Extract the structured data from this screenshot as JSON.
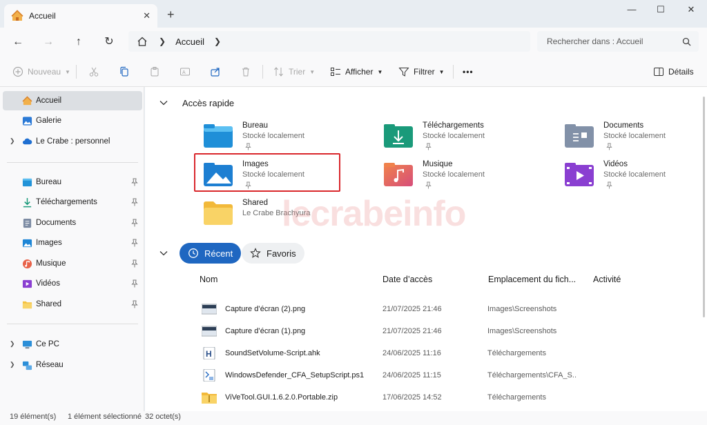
{
  "window": {
    "tab_title": "Accueil",
    "tab_close": "✕",
    "new_tab": "+",
    "minimize": "—",
    "maximize": "☐",
    "close": "✕"
  },
  "address": {
    "crumb": "Accueil",
    "search_placeholder": "Rechercher dans : Accueil"
  },
  "toolbar": {
    "new_label": "Nouveau",
    "sort_label": "Trier",
    "view_label": "Afficher",
    "filter_label": "Filtrer",
    "more_label": "•••",
    "details_label": "Détails"
  },
  "sidebar": {
    "items": [
      {
        "label": "Accueil"
      },
      {
        "label": "Galerie"
      },
      {
        "label": "Le Crabe : personnel"
      },
      {
        "label": "Bureau"
      },
      {
        "label": "Téléchargements"
      },
      {
        "label": "Documents"
      },
      {
        "label": "Images"
      },
      {
        "label": "Musique"
      },
      {
        "label": "Vidéos"
      },
      {
        "label": "Shared"
      },
      {
        "label": "Ce PC"
      },
      {
        "label": "Réseau"
      }
    ]
  },
  "quick_access": {
    "title": "Accès rapide",
    "items": [
      {
        "name": "Bureau",
        "sub": "Stocké localement"
      },
      {
        "name": "Téléchargements",
        "sub": "Stocké localement"
      },
      {
        "name": "Documents",
        "sub": "Stocké localement"
      },
      {
        "name": "Images",
        "sub": "Stocké localement"
      },
      {
        "name": "Musique",
        "sub": "Stocké localement"
      },
      {
        "name": "Vidéos",
        "sub": "Stocké localement"
      },
      {
        "name": "Shared",
        "sub": "Le Crabe Brachyura"
      }
    ]
  },
  "watermark": "lecrabeinfo",
  "recent_tabs": {
    "recent": "Récent",
    "favorites": "Favoris"
  },
  "columns": {
    "name": "Nom",
    "date": "Date d’accès",
    "location": "Emplacement du fich...",
    "activity": "Activité"
  },
  "files": [
    {
      "name": "Capture d’écran (2).png",
      "date": "21/07/2025 21:46",
      "location": "Images\\Screenshots",
      "icon": "image-file-icon"
    },
    {
      "name": "Capture d’écran (1).png",
      "date": "21/07/2025 21:46",
      "location": "Images\\Screenshots",
      "icon": "image-file-icon"
    },
    {
      "name": "SoundSetVolume-Script.ahk",
      "date": "24/06/2025 11:16",
      "location": "Téléchargements",
      "icon": "ahk-file-icon"
    },
    {
      "name": "WindowsDefender_CFA_SetupScript.ps1",
      "date": "24/06/2025 11:15",
      "location": "Téléchargements\\CFA_S...",
      "icon": "script-file-icon"
    },
    {
      "name": "ViVeTool.GUI.1.6.2.0.Portable.zip",
      "date": "17/06/2025 14:52",
      "location": "Téléchargements",
      "icon": "zip-folder-icon"
    }
  ],
  "status": {
    "count": "19 élément(s)",
    "selected": "1 élément sélectionné",
    "size": "32 octet(s)"
  },
  "colors": {
    "accent": "#1f67c1",
    "highlight": "#d9262b"
  }
}
